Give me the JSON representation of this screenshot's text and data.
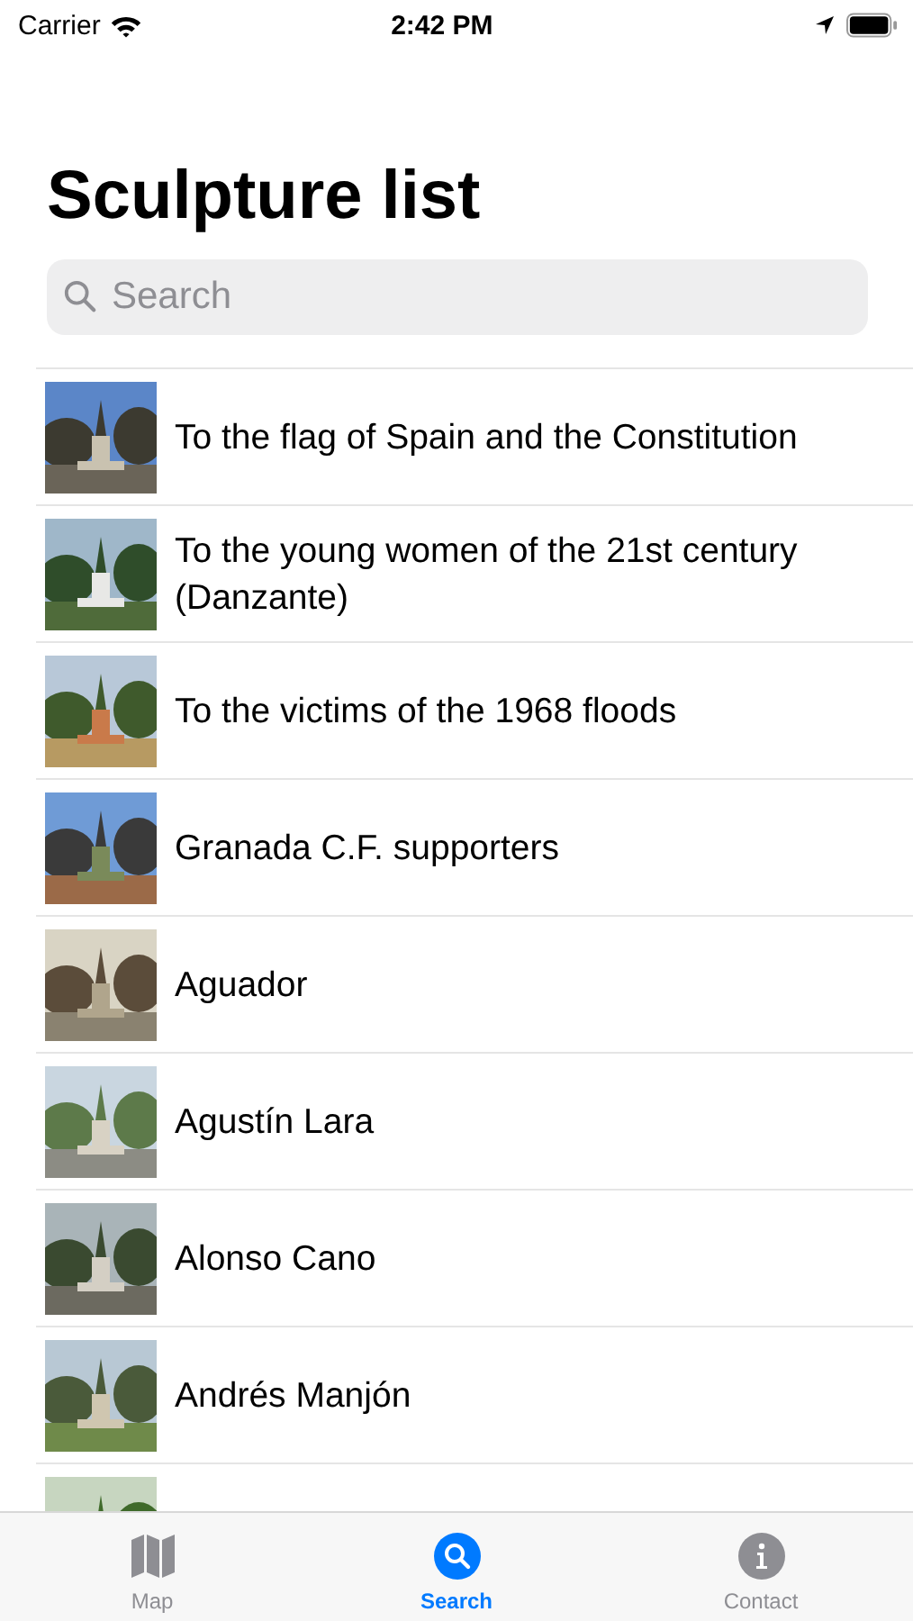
{
  "status_bar": {
    "carrier": "Carrier",
    "time": "2:42 PM"
  },
  "title": "Sculpture list",
  "search": {
    "placeholder": "Search"
  },
  "rows": [
    {
      "title": "To the flag of Spain and the Constitution"
    },
    {
      "title": "To the young women of the 21st century (Danzante)"
    },
    {
      "title": "To the victims of the 1968 floods"
    },
    {
      "title": "Granada C.F. supporters"
    },
    {
      "title": "Aguador"
    },
    {
      "title": "Agustín Lara"
    },
    {
      "title": "Alonso Cano"
    },
    {
      "title": "Andrés Manjón"
    },
    {}
  ],
  "tab_bar": [
    {
      "label": "Map",
      "kind": "map",
      "selected": false
    },
    {
      "label": "Search",
      "kind": "search",
      "selected": true
    },
    {
      "label": "Contact",
      "kind": "info",
      "selected": false
    }
  ]
}
